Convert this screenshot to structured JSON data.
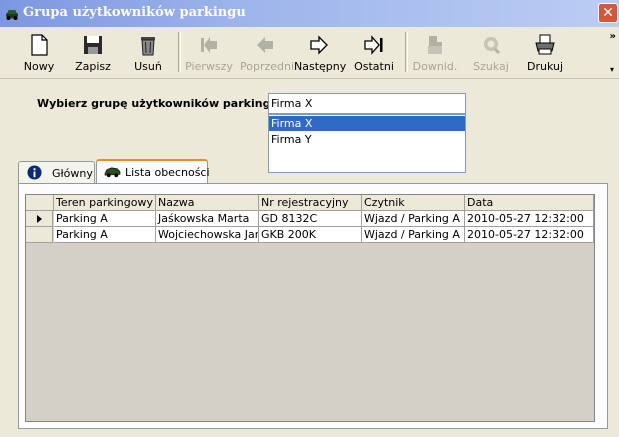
{
  "window": {
    "title": "Grupa użytkowników parkingu",
    "close_label": "✕"
  },
  "toolbar": {
    "buttons": [
      {
        "label": "Nowy",
        "icon": "new-document-icon",
        "enabled": true
      },
      {
        "label": "Zapisz",
        "icon": "floppy-disk-icon",
        "enabled": true
      },
      {
        "label": "Usuń",
        "icon": "trash-can-icon",
        "enabled": true
      },
      {
        "label": "Pierwszy",
        "icon": "first-record-icon",
        "enabled": false
      },
      {
        "label": "Poprzedni",
        "icon": "previous-record-icon",
        "enabled": false
      },
      {
        "label": "Następny",
        "icon": "next-record-icon",
        "enabled": true
      },
      {
        "label": "Ostatni",
        "icon": "last-record-icon",
        "enabled": true
      },
      {
        "label": "Downld.",
        "icon": "download-icon",
        "enabled": false
      },
      {
        "label": "Szukaj",
        "icon": "search-icon",
        "enabled": false
      },
      {
        "label": "Drukuj",
        "icon": "printer-icon",
        "enabled": true
      }
    ],
    "overflow_label": "»",
    "overflow_dropdown_label": "▾"
  },
  "group_select": {
    "label": "Wybierz grupę użytkowników parkingu :",
    "value": "Firma X",
    "options": [
      "Firma X",
      "Firma Y"
    ],
    "selected_index": 0
  },
  "tabs": [
    {
      "label": "Główny",
      "icon": "info-icon",
      "active": false
    },
    {
      "label": "Lista obecności",
      "icon": "car-icon",
      "active": true
    }
  ],
  "table": {
    "columns": [
      "Teren parkingowy",
      "Nazwa",
      "Nr rejestracyjny",
      "Czytnik",
      "Data"
    ],
    "rows": [
      [
        "Parking A",
        "Jaśkowska Marta",
        "GD 8132C",
        "Wjazd / Parking A",
        "2010-05-27 12:32:00"
      ],
      [
        "Parking A",
        "Wojciechowska  Jar",
        "GKB 200K",
        "Wjazd / Parking A",
        "2010-05-27 12:32:00"
      ]
    ],
    "current_row": 0
  },
  "colors": {
    "title_gradient_start": "#7b97e0",
    "close_button": "#d8553a",
    "selection": "#316ac5",
    "active_tab_accent": "#e68b2c",
    "grid_background": "#d4d0c8"
  }
}
